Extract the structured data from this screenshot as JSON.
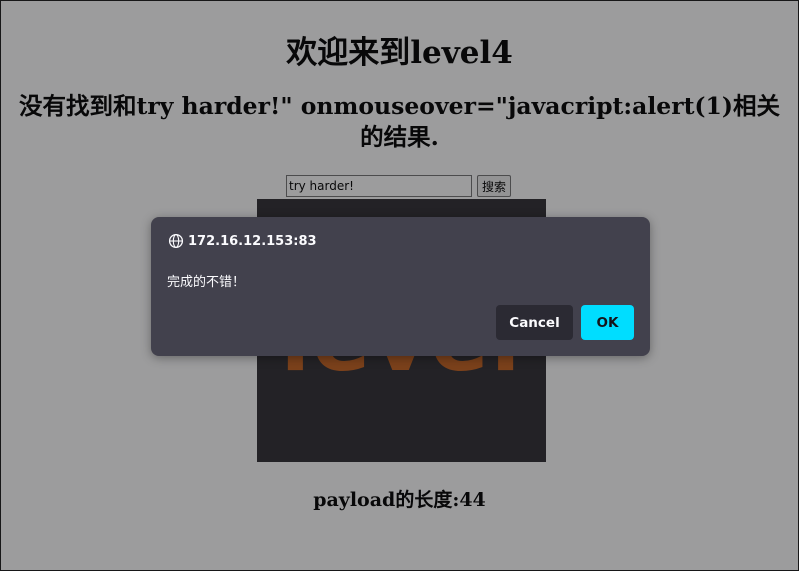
{
  "page": {
    "title": "欢迎来到level4",
    "result_text": "没有找到和try harder!\" onmouseover=\"javacript:alert(1)相关的结果.",
    "search": {
      "value": "try harder!",
      "button_label": "搜索"
    },
    "image_text": "level",
    "payload_length_text": "payload的长度:44"
  },
  "dialog": {
    "origin": "172.16.12.153:83",
    "message": "完成的不错！",
    "cancel_label": "Cancel",
    "ok_label": "OK"
  },
  "colors": {
    "dialog_background": "#42414d",
    "ok_button": "#00ddff",
    "cancel_button": "#2b2a33",
    "image_background": "#2f2e33",
    "image_text": "#c6621f"
  },
  "icons": {
    "origin_icon": "globe-icon"
  }
}
